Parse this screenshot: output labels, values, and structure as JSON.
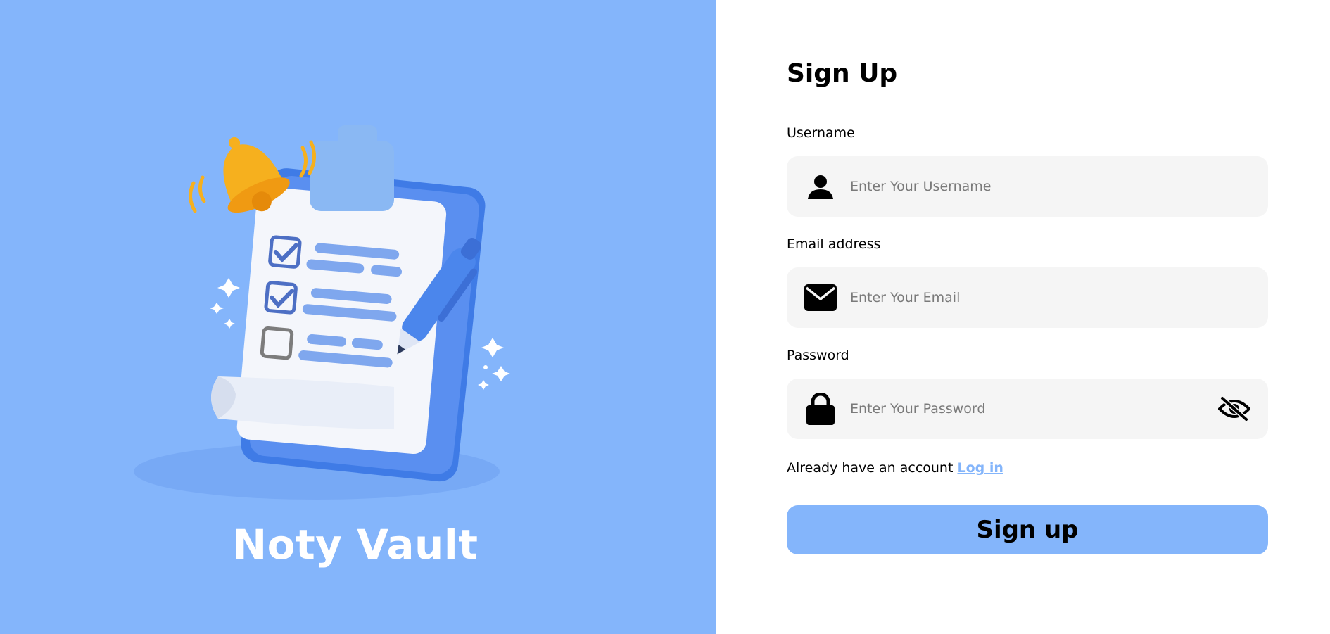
{
  "brand": {
    "name": "Noty Vault",
    "background_color": "#84b5fb"
  },
  "illustration": {
    "subject": "clipboard-checklist-with-bell-and-pen"
  },
  "form": {
    "title": "Sign Up",
    "username": {
      "label": "Username",
      "placeholder": "Enter Your Username",
      "value": "",
      "icon": "user-icon"
    },
    "email": {
      "label": "Email address",
      "placeholder": "Enter Your Email",
      "value": "",
      "icon": "envelope-icon"
    },
    "password": {
      "label": "Password",
      "placeholder": "Enter Your Password",
      "value": "",
      "icon": "lock-icon",
      "toggle_icon": "eye-slash-icon"
    },
    "account_prompt": "Already have an account",
    "login_link": "Log in",
    "submit_label": "Sign up",
    "accent_color": "#84b5fb",
    "field_background": "#f5f5f5"
  }
}
